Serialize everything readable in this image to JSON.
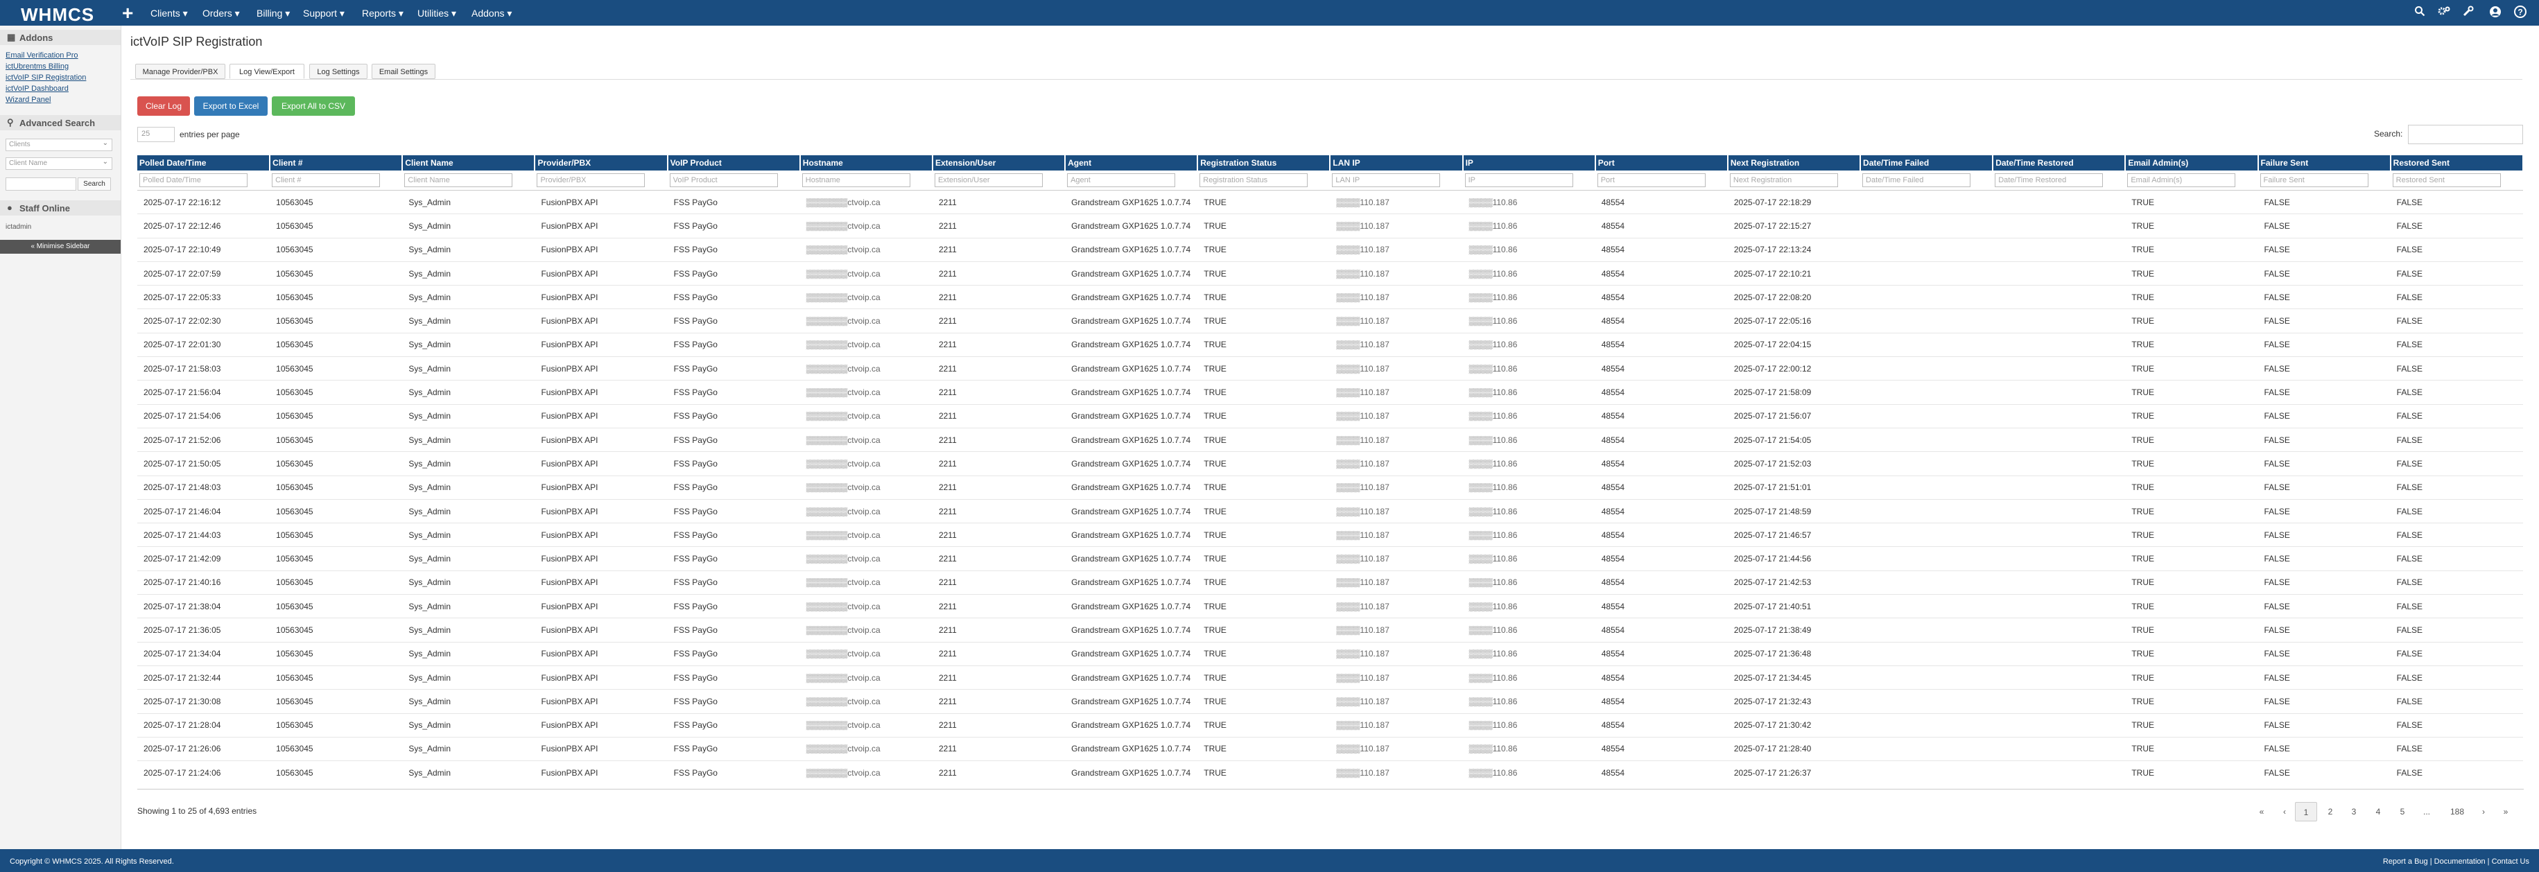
{
  "topbar": {
    "logo": "WHMCS",
    "plus": "+",
    "nav": [
      "Clients ▾",
      "Orders ▾",
      "Billing ▾",
      "Support ▾",
      "Reports ▾",
      "Utilities ▾",
      "Addons ▾"
    ],
    "icons": [
      "search-icon",
      "cog-icon",
      "wrench-icon",
      "user-avatar-icon",
      "help-icon"
    ]
  },
  "sidebar": {
    "addons_title": "Addons",
    "addon_links": [
      "Email Verification Pro",
      "ictUbrentms Billing",
      "ictVoIP SIP Registration",
      "ictVoIP Dashboard",
      "Wizard Panel"
    ],
    "advanced_search_title": "Advanced Search",
    "search_type_value": "Clients",
    "search_field_value": "Client Name",
    "search_button": "Search",
    "staff_title": "Staff Online",
    "staff_user": "ictadmin",
    "minimize": "« Minimise Sidebar"
  },
  "page": {
    "title": "ictVoIP SIP Registration",
    "tabs": [
      "Manage Provider/PBX",
      "Log View/Export",
      "Log Settings",
      "Email Settings"
    ],
    "active_tab": 1,
    "buttons": {
      "clear": "Clear Log",
      "excel": "Export to Excel",
      "csv": "Export All to CSV"
    },
    "colors": {
      "header": "#1a4d80",
      "clear": "#d9534f",
      "excel": "#337ab7",
      "csv": "#5cb85c"
    },
    "page_length": "25",
    "entries_label": "entries per page",
    "search_label": "Search:"
  },
  "table": {
    "columns": [
      "Polled Date/Time",
      "Client #",
      "Client Name",
      "Provider/PBX",
      "VoIP Product",
      "Hostname",
      "Extension/User",
      "Agent",
      "Registration Status",
      "LAN IP",
      "IP",
      "Port",
      "Next Registration",
      "Date/Time Failed",
      "Date/Time Restored",
      "Email Admin(s)",
      "Failure Sent",
      "Restored Sent"
    ],
    "rows": [
      [
        "2025-07-17 22:16:12",
        "10563045",
        "Sys_Admin",
        "FusionPBX API",
        "FSS PayGo",
        "▒▒▒▒▒▒▒ctvoip.ca",
        "2211",
        "Grandstream GXP1625 1.0.7.74",
        "TRUE",
        "▒▒▒▒110.187",
        "▒▒▒▒110.86",
        "48554",
        "2025-07-17 22:18:29",
        "",
        "",
        "TRUE",
        "FALSE",
        "FALSE"
      ],
      [
        "2025-07-17 22:12:46",
        "10563045",
        "Sys_Admin",
        "FusionPBX API",
        "FSS PayGo",
        "▒▒▒▒▒▒▒ctvoip.ca",
        "2211",
        "Grandstream GXP1625 1.0.7.74",
        "TRUE",
        "▒▒▒▒110.187",
        "▒▒▒▒110.86",
        "48554",
        "2025-07-17 22:15:27",
        "",
        "",
        "TRUE",
        "FALSE",
        "FALSE"
      ],
      [
        "2025-07-17 22:10:49",
        "10563045",
        "Sys_Admin",
        "FusionPBX API",
        "FSS PayGo",
        "▒▒▒▒▒▒▒ctvoip.ca",
        "2211",
        "Grandstream GXP1625 1.0.7.74",
        "TRUE",
        "▒▒▒▒110.187",
        "▒▒▒▒110.86",
        "48554",
        "2025-07-17 22:13:24",
        "",
        "",
        "TRUE",
        "FALSE",
        "FALSE"
      ],
      [
        "2025-07-17 22:07:59",
        "10563045",
        "Sys_Admin",
        "FusionPBX API",
        "FSS PayGo",
        "▒▒▒▒▒▒▒ctvoip.ca",
        "2211",
        "Grandstream GXP1625 1.0.7.74",
        "TRUE",
        "▒▒▒▒110.187",
        "▒▒▒▒110.86",
        "48554",
        "2025-07-17 22:10:21",
        "",
        "",
        "TRUE",
        "FALSE",
        "FALSE"
      ],
      [
        "2025-07-17 22:05:33",
        "10563045",
        "Sys_Admin",
        "FusionPBX API",
        "FSS PayGo",
        "▒▒▒▒▒▒▒ctvoip.ca",
        "2211",
        "Grandstream GXP1625 1.0.7.74",
        "TRUE",
        "▒▒▒▒110.187",
        "▒▒▒▒110.86",
        "48554",
        "2025-07-17 22:08:20",
        "",
        "",
        "TRUE",
        "FALSE",
        "FALSE"
      ],
      [
        "2025-07-17 22:02:30",
        "10563045",
        "Sys_Admin",
        "FusionPBX API",
        "FSS PayGo",
        "▒▒▒▒▒▒▒ctvoip.ca",
        "2211",
        "Grandstream GXP1625 1.0.7.74",
        "TRUE",
        "▒▒▒▒110.187",
        "▒▒▒▒110.86",
        "48554",
        "2025-07-17 22:05:16",
        "",
        "",
        "TRUE",
        "FALSE",
        "FALSE"
      ],
      [
        "2025-07-17 22:01:30",
        "10563045",
        "Sys_Admin",
        "FusionPBX API",
        "FSS PayGo",
        "▒▒▒▒▒▒▒ctvoip.ca",
        "2211",
        "Grandstream GXP1625 1.0.7.74",
        "TRUE",
        "▒▒▒▒110.187",
        "▒▒▒▒110.86",
        "48554",
        "2025-07-17 22:04:15",
        "",
        "",
        "TRUE",
        "FALSE",
        "FALSE"
      ],
      [
        "2025-07-17 21:58:03",
        "10563045",
        "Sys_Admin",
        "FusionPBX API",
        "FSS PayGo",
        "▒▒▒▒▒▒▒ctvoip.ca",
        "2211",
        "Grandstream GXP1625 1.0.7.74",
        "TRUE",
        "▒▒▒▒110.187",
        "▒▒▒▒110.86",
        "48554",
        "2025-07-17 22:00:12",
        "",
        "",
        "TRUE",
        "FALSE",
        "FALSE"
      ],
      [
        "2025-07-17 21:56:04",
        "10563045",
        "Sys_Admin",
        "FusionPBX API",
        "FSS PayGo",
        "▒▒▒▒▒▒▒ctvoip.ca",
        "2211",
        "Grandstream GXP1625 1.0.7.74",
        "TRUE",
        "▒▒▒▒110.187",
        "▒▒▒▒110.86",
        "48554",
        "2025-07-17 21:58:09",
        "",
        "",
        "TRUE",
        "FALSE",
        "FALSE"
      ],
      [
        "2025-07-17 21:54:06",
        "10563045",
        "Sys_Admin",
        "FusionPBX API",
        "FSS PayGo",
        "▒▒▒▒▒▒▒ctvoip.ca",
        "2211",
        "Grandstream GXP1625 1.0.7.74",
        "TRUE",
        "▒▒▒▒110.187",
        "▒▒▒▒110.86",
        "48554",
        "2025-07-17 21:56:07",
        "",
        "",
        "TRUE",
        "FALSE",
        "FALSE"
      ],
      [
        "2025-07-17 21:52:06",
        "10563045",
        "Sys_Admin",
        "FusionPBX API",
        "FSS PayGo",
        "▒▒▒▒▒▒▒ctvoip.ca",
        "2211",
        "Grandstream GXP1625 1.0.7.74",
        "TRUE",
        "▒▒▒▒110.187",
        "▒▒▒▒110.86",
        "48554",
        "2025-07-17 21:54:05",
        "",
        "",
        "TRUE",
        "FALSE",
        "FALSE"
      ],
      [
        "2025-07-17 21:50:05",
        "10563045",
        "Sys_Admin",
        "FusionPBX API",
        "FSS PayGo",
        "▒▒▒▒▒▒▒ctvoip.ca",
        "2211",
        "Grandstream GXP1625 1.0.7.74",
        "TRUE",
        "▒▒▒▒110.187",
        "▒▒▒▒110.86",
        "48554",
        "2025-07-17 21:52:03",
        "",
        "",
        "TRUE",
        "FALSE",
        "FALSE"
      ],
      [
        "2025-07-17 21:48:03",
        "10563045",
        "Sys_Admin",
        "FusionPBX API",
        "FSS PayGo",
        "▒▒▒▒▒▒▒ctvoip.ca",
        "2211",
        "Grandstream GXP1625 1.0.7.74",
        "TRUE",
        "▒▒▒▒110.187",
        "▒▒▒▒110.86",
        "48554",
        "2025-07-17 21:51:01",
        "",
        "",
        "TRUE",
        "FALSE",
        "FALSE"
      ],
      [
        "2025-07-17 21:46:04",
        "10563045",
        "Sys_Admin",
        "FusionPBX API",
        "FSS PayGo",
        "▒▒▒▒▒▒▒ctvoip.ca",
        "2211",
        "Grandstream GXP1625 1.0.7.74",
        "TRUE",
        "▒▒▒▒110.187",
        "▒▒▒▒110.86",
        "48554",
        "2025-07-17 21:48:59",
        "",
        "",
        "TRUE",
        "FALSE",
        "FALSE"
      ],
      [
        "2025-07-17 21:44:03",
        "10563045",
        "Sys_Admin",
        "FusionPBX API",
        "FSS PayGo",
        "▒▒▒▒▒▒▒ctvoip.ca",
        "2211",
        "Grandstream GXP1625 1.0.7.74",
        "TRUE",
        "▒▒▒▒110.187",
        "▒▒▒▒110.86",
        "48554",
        "2025-07-17 21:46:57",
        "",
        "",
        "TRUE",
        "FALSE",
        "FALSE"
      ],
      [
        "2025-07-17 21:42:09",
        "10563045",
        "Sys_Admin",
        "FusionPBX API",
        "FSS PayGo",
        "▒▒▒▒▒▒▒ctvoip.ca",
        "2211",
        "Grandstream GXP1625 1.0.7.74",
        "TRUE",
        "▒▒▒▒110.187",
        "▒▒▒▒110.86",
        "48554",
        "2025-07-17 21:44:56",
        "",
        "",
        "TRUE",
        "FALSE",
        "FALSE"
      ],
      [
        "2025-07-17 21:40:16",
        "10563045",
        "Sys_Admin",
        "FusionPBX API",
        "FSS PayGo",
        "▒▒▒▒▒▒▒ctvoip.ca",
        "2211",
        "Grandstream GXP1625 1.0.7.74",
        "TRUE",
        "▒▒▒▒110.187",
        "▒▒▒▒110.86",
        "48554",
        "2025-07-17 21:42:53",
        "",
        "",
        "TRUE",
        "FALSE",
        "FALSE"
      ],
      [
        "2025-07-17 21:38:04",
        "10563045",
        "Sys_Admin",
        "FusionPBX API",
        "FSS PayGo",
        "▒▒▒▒▒▒▒ctvoip.ca",
        "2211",
        "Grandstream GXP1625 1.0.7.74",
        "TRUE",
        "▒▒▒▒110.187",
        "▒▒▒▒110.86",
        "48554",
        "2025-07-17 21:40:51",
        "",
        "",
        "TRUE",
        "FALSE",
        "FALSE"
      ],
      [
        "2025-07-17 21:36:05",
        "10563045",
        "Sys_Admin",
        "FusionPBX API",
        "FSS PayGo",
        "▒▒▒▒▒▒▒ctvoip.ca",
        "2211",
        "Grandstream GXP1625 1.0.7.74",
        "TRUE",
        "▒▒▒▒110.187",
        "▒▒▒▒110.86",
        "48554",
        "2025-07-17 21:38:49",
        "",
        "",
        "TRUE",
        "FALSE",
        "FALSE"
      ],
      [
        "2025-07-17 21:34:04",
        "10563045",
        "Sys_Admin",
        "FusionPBX API",
        "FSS PayGo",
        "▒▒▒▒▒▒▒ctvoip.ca",
        "2211",
        "Grandstream GXP1625 1.0.7.74",
        "TRUE",
        "▒▒▒▒110.187",
        "▒▒▒▒110.86",
        "48554",
        "2025-07-17 21:36:48",
        "",
        "",
        "TRUE",
        "FALSE",
        "FALSE"
      ],
      [
        "2025-07-17 21:32:44",
        "10563045",
        "Sys_Admin",
        "FusionPBX API",
        "FSS PayGo",
        "▒▒▒▒▒▒▒ctvoip.ca",
        "2211",
        "Grandstream GXP1625 1.0.7.74",
        "TRUE",
        "▒▒▒▒110.187",
        "▒▒▒▒110.86",
        "48554",
        "2025-07-17 21:34:45",
        "",
        "",
        "TRUE",
        "FALSE",
        "FALSE"
      ],
      [
        "2025-07-17 21:30:08",
        "10563045",
        "Sys_Admin",
        "FusionPBX API",
        "FSS PayGo",
        "▒▒▒▒▒▒▒ctvoip.ca",
        "2211",
        "Grandstream GXP1625 1.0.7.74",
        "TRUE",
        "▒▒▒▒110.187",
        "▒▒▒▒110.86",
        "48554",
        "2025-07-17 21:32:43",
        "",
        "",
        "TRUE",
        "FALSE",
        "FALSE"
      ],
      [
        "2025-07-17 21:28:04",
        "10563045",
        "Sys_Admin",
        "FusionPBX API",
        "FSS PayGo",
        "▒▒▒▒▒▒▒ctvoip.ca",
        "2211",
        "Grandstream GXP1625 1.0.7.74",
        "TRUE",
        "▒▒▒▒110.187",
        "▒▒▒▒110.86",
        "48554",
        "2025-07-17 21:30:42",
        "",
        "",
        "TRUE",
        "FALSE",
        "FALSE"
      ],
      [
        "2025-07-17 21:26:06",
        "10563045",
        "Sys_Admin",
        "FusionPBX API",
        "FSS PayGo",
        "▒▒▒▒▒▒▒ctvoip.ca",
        "2211",
        "Grandstream GXP1625 1.0.7.74",
        "TRUE",
        "▒▒▒▒110.187",
        "▒▒▒▒110.86",
        "48554",
        "2025-07-17 21:28:40",
        "",
        "",
        "TRUE",
        "FALSE",
        "FALSE"
      ],
      [
        "2025-07-17 21:24:06",
        "10563045",
        "Sys_Admin",
        "FusionPBX API",
        "FSS PayGo",
        "▒▒▒▒▒▒▒ctvoip.ca",
        "2211",
        "Grandstream GXP1625 1.0.7.74",
        "TRUE",
        "▒▒▒▒110.187",
        "▒▒▒▒110.86",
        "48554",
        "2025-07-17 21:26:37",
        "",
        "",
        "TRUE",
        "FALSE",
        "FALSE"
      ]
    ]
  },
  "info": "Showing 1 to 25 of 4,693 entries",
  "pagination": [
    "«",
    "‹",
    "1",
    "2",
    "3",
    "4",
    "5",
    "...",
    "188",
    "›",
    "»"
  ],
  "active_page": "1",
  "footer": {
    "copyright": "Copyright © WHMCS 2025. All Rights Reserved.",
    "links": "Report a Bug | Documentation | Contact Us"
  }
}
